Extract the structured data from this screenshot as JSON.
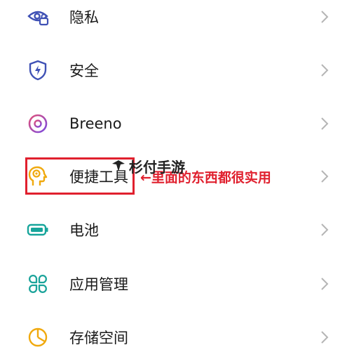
{
  "settings_items": [
    {
      "label": "隐私",
      "icon": "privacy-icon"
    },
    {
      "label": "安全",
      "icon": "security-shield-icon"
    },
    {
      "label": "Breeno",
      "icon": "breeno-icon"
    },
    {
      "label": "便捷工具",
      "icon": "convenience-tools-icon"
    },
    {
      "label": "电池",
      "icon": "battery-icon"
    },
    {
      "label": "应用管理",
      "icon": "app-management-icon"
    },
    {
      "label": "存储空间",
      "icon": "storage-icon"
    }
  ],
  "annotation": {
    "text": "←里面的东西都很实用",
    "color": "#e0202e"
  },
  "watermark": {
    "text": "杉付手游"
  },
  "colors": {
    "accent_blue": "#3f51b5",
    "breeno": "#9c4bd1",
    "tools": "#f0a90e",
    "battery": "#17a59b",
    "apps": "#1aa39a",
    "storage": "#f0a90e"
  }
}
